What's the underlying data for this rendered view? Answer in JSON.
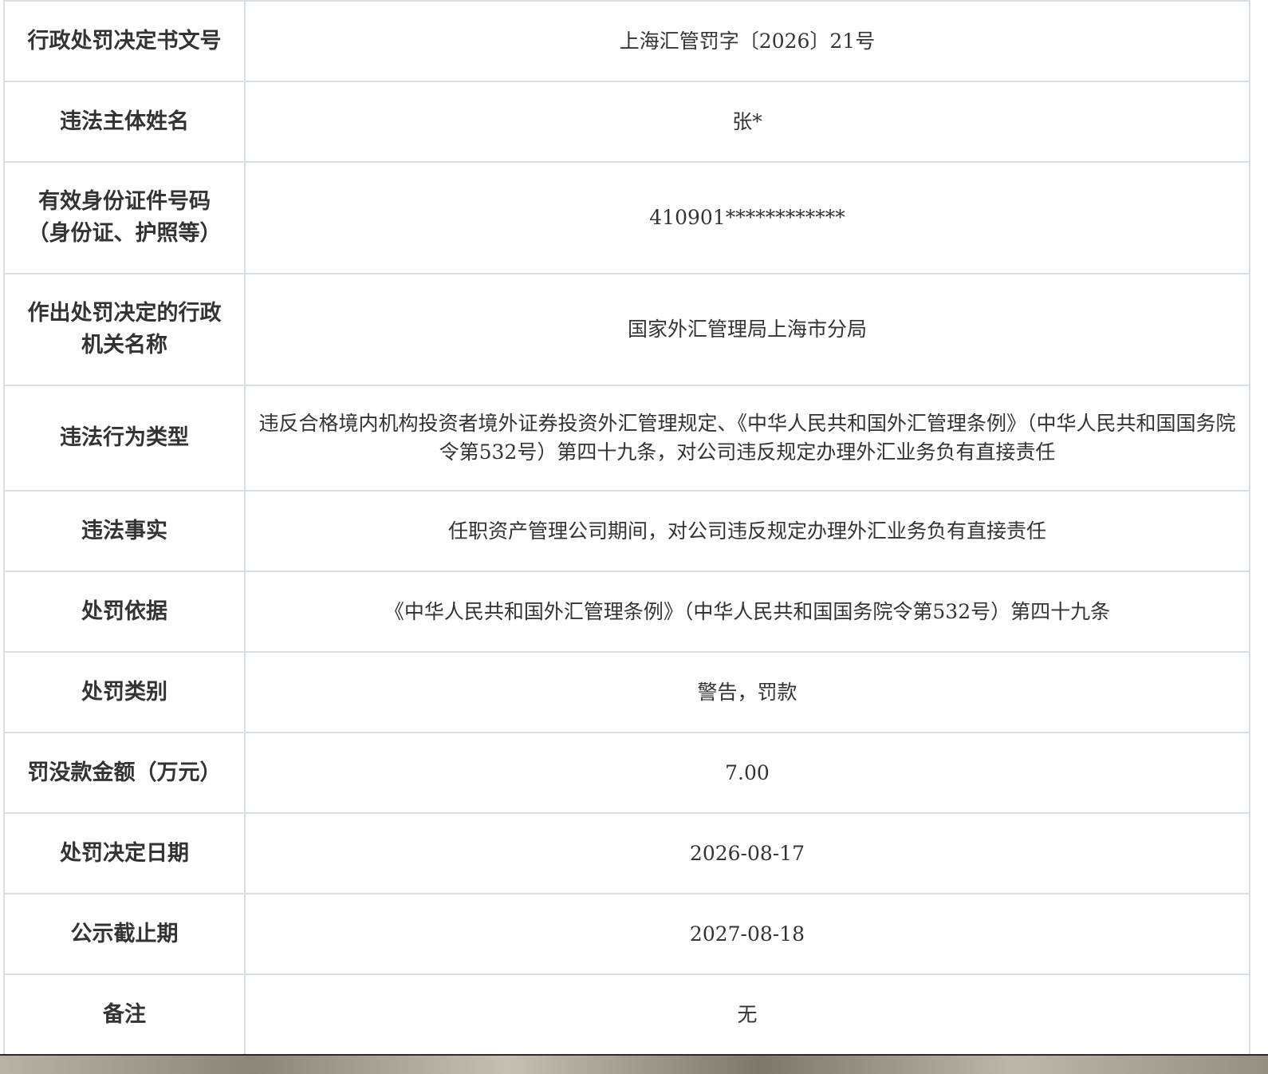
{
  "record": {
    "rows": [
      {
        "label": "行政处罚决定书文号",
        "value": "上海汇管罚字〔2026〕21号"
      },
      {
        "label": "违法主体姓名",
        "value": "张*"
      },
      {
        "label": "有效身份证件号码（身份证、护照等）",
        "value": "410901************"
      },
      {
        "label": "作出处罚决定的行政机关名称",
        "value": "国家外汇管理局上海市分局"
      },
      {
        "label": "违法行为类型",
        "value": "违反合格境内机构投资者境外证券投资外汇管理规定、《中华人民共和国外汇管理条例》（中华人民共和国国务院令第532号）第四十九条，对公司违反规定办理外汇业务负有直接责任"
      },
      {
        "label": "违法事实",
        "value": "任职资产管理公司期间，对公司违反规定办理外汇业务负有直接责任"
      },
      {
        "label": "处罚依据",
        "value": "《中华人民共和国外汇管理条例》（中华人民共和国国务院令第532号）第四十九条"
      },
      {
        "label": "处罚类别",
        "value": "警告，罚款"
      },
      {
        "label": "罚没款金额（万元）",
        "value": "7.00"
      },
      {
        "label": "处罚决定日期",
        "value": "2026-08-17"
      },
      {
        "label": "公示截止期",
        "value": "2027-08-18"
      },
      {
        "label": "备注",
        "value": "无"
      }
    ]
  }
}
